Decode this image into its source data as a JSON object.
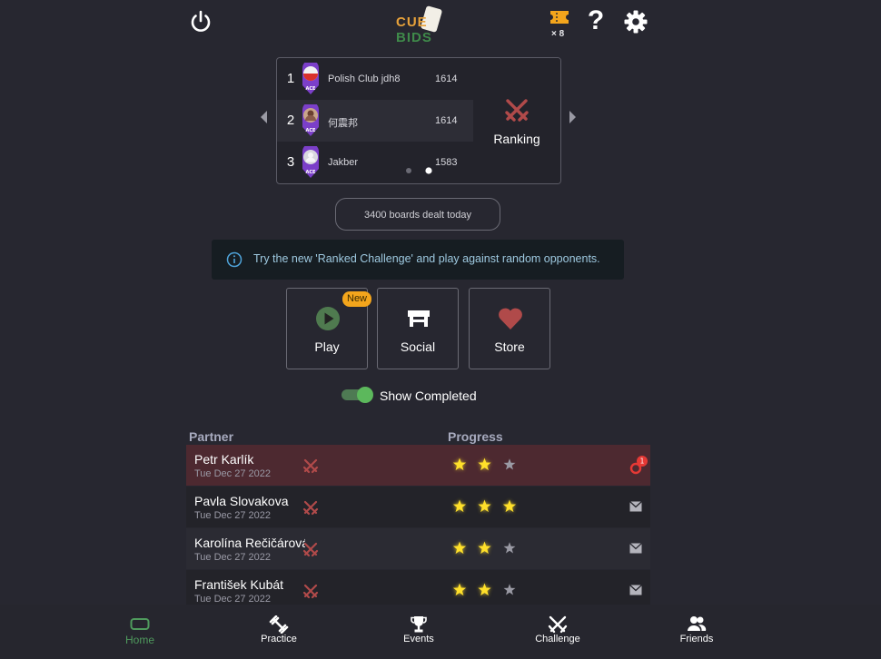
{
  "header": {
    "logo_top": "CUE",
    "logo_bottom": "BIDS",
    "tickets_count": "× 8",
    "help_label": "?"
  },
  "ranking": {
    "rows": [
      {
        "rank": "1",
        "name": "Polish Club jdh8",
        "score": "1614",
        "badge": "ACE"
      },
      {
        "rank": "2",
        "name": "何震邦",
        "score": "1614",
        "badge": "ACE"
      },
      {
        "rank": "3",
        "name": "Jakber",
        "score": "1583",
        "badge": "ACE"
      }
    ],
    "side_label": "Ranking",
    "active_page": 2,
    "page_count": 2
  },
  "boards_today": "3400 boards dealt today",
  "info_banner": "Try the new 'Ranked Challenge' and play against random opponents.",
  "tiles": {
    "play": {
      "label": "Play",
      "badge": "New"
    },
    "social": {
      "label": "Social"
    },
    "store": {
      "label": "Store"
    }
  },
  "toggle": {
    "label": "Show Completed",
    "on": true
  },
  "table": {
    "headers": {
      "partner": "Partner",
      "progress": "Progress"
    },
    "rows": [
      {
        "partner": "Petr Karlík",
        "date": "Tue Dec 27 2022",
        "stars": 2,
        "status": "alert",
        "alert_count": "1"
      },
      {
        "partner": "Pavla Slovakova",
        "date": "Tue Dec 27 2022",
        "stars": 3,
        "status": "message"
      },
      {
        "partner": "Karolína Rečičárová",
        "date": "Tue Dec 27 2022",
        "stars": 2,
        "status": "message"
      },
      {
        "partner": "František Kubát",
        "date": "Tue Dec 27 2022",
        "stars": 2,
        "status": "message"
      }
    ]
  },
  "nav": {
    "home": "Home",
    "practice": "Practice",
    "events": "Events",
    "challenge": "Challenge",
    "friends": "Friends"
  },
  "colors": {
    "background": "#272730",
    "accent_green": "#4f9a5d",
    "star_yellow": "#ffe02a",
    "ranking_red": "#b04a4a",
    "alert_red": "#e53935",
    "badge_orange": "#f3a51c"
  }
}
